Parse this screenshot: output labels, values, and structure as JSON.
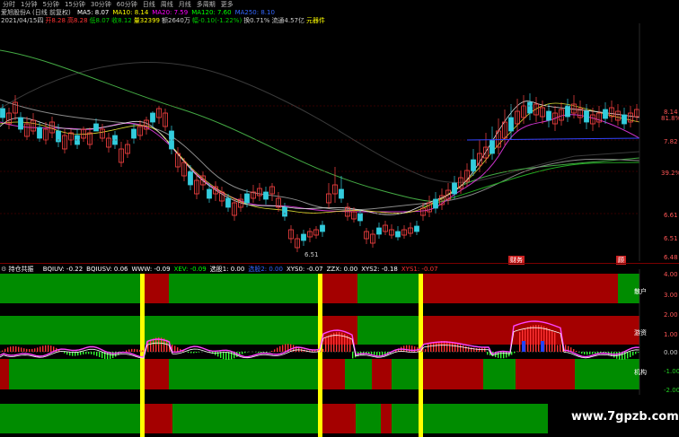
{
  "toolbar": {
    "tabs": [
      "分时",
      "1分钟",
      "5分钟",
      "15分钟",
      "30分钟",
      "60分钟",
      "日线",
      "周线",
      "月线",
      "多周期",
      "更多"
    ]
  },
  "upper": {
    "title": "爱旭股份A (日线 前复权)",
    "ma_line": [
      {
        "text": "MA5: 8.07",
        "color": "#ffffff"
      },
      {
        "text": "MA10: 8.14",
        "color": "#ffff00"
      },
      {
        "text": "MA20: 7.59",
        "color": "#ff00ff"
      },
      {
        "text": "MA120: 7.60",
        "color": "#00ff00"
      },
      {
        "text": "MA250: 8.10",
        "color": "#3366ff"
      }
    ],
    "info_line": [
      {
        "text": "2021/04/15四",
        "color": "#cccccc"
      },
      {
        "text": "开8.28",
        "color": "#ff3333"
      },
      {
        "text": "高8.28",
        "color": "#ff3333"
      },
      {
        "text": "低8.07",
        "color": "#00cc00"
      },
      {
        "text": "收8.12",
        "color": "#00cc00"
      },
      {
        "text": "量32399",
        "color": "#ffff00"
      },
      {
        "text": "额2640万",
        "color": "#cccccc"
      },
      {
        "text": "幅-0.10(-1.22%)",
        "color": "#00cc00"
      },
      {
        "text": "换0.71%",
        "color": "#cccccc"
      },
      {
        "text": "流通4.57亿",
        "color": "#cccccc"
      },
      {
        "text": "元器件",
        "color": "#ffff00"
      }
    ],
    "price_labels": [
      "8.14",
      "81.8%",
      "7.82",
      "39.2%",
      "6.61",
      "6.51",
      "6.48"
    ],
    "low_label": "6.51",
    "markers": [
      "财务",
      "顾"
    ]
  },
  "lower": {
    "title": "持仓共振",
    "indicators": [
      {
        "text": "BQIUV: -0.22",
        "color": "#ffffff"
      },
      {
        "text": "BQIUSV: 0.06",
        "color": "#ffffff"
      },
      {
        "text": "WWW: -0.09",
        "color": "#ffffff"
      },
      {
        "text": "XEV: -0.09",
        "color": "#00ff00"
      },
      {
        "text": "选股1: 0.00",
        "color": "#ffffff"
      },
      {
        "text": "选股2: 0.00",
        "color": "#3366ff"
      },
      {
        "text": "XYS0: -0.07",
        "color": "#ffffff"
      },
      {
        "text": "ZZX: 0.00",
        "color": "#ffffff"
      },
      {
        "text": "XYS2: -0.18",
        "color": "#ffffff"
      },
      {
        "text": "XYS1: -0.07",
        "color": "#ff3333"
      }
    ],
    "axis_labels": [
      "4.00",
      "3.00",
      "2.00",
      "1.00",
      "0.00",
      "-1.00",
      "-2.00"
    ],
    "band_labels": [
      "散户",
      "游资",
      "机构"
    ]
  },
  "watermark": "www.7gpzb.com",
  "colors": {
    "green": "#008c00",
    "red": "#a40000",
    "yellow": "#ffff00",
    "magenta": "#ff44ff"
  }
}
